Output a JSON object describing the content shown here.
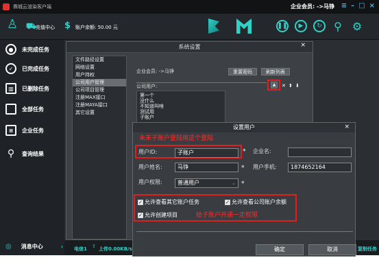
{
  "app": {
    "title": "赛城云渲染客户端",
    "member_label": "企业会员: ->马铮",
    "balance": "账户余额: 50.00 元",
    "recharge": "充值中心"
  },
  "sidebar": {
    "items": [
      {
        "label": "未完成任务",
        "icon": "circle-dot-icon"
      },
      {
        "label": "已完成任务",
        "icon": "check-circle-icon"
      },
      {
        "label": "已删除任务",
        "icon": "trash-icon"
      },
      {
        "label": "全部任务",
        "icon": "file-icon"
      },
      {
        "label": "企业任务",
        "icon": "list-icon"
      },
      {
        "label": "查询结果",
        "icon": "search-icon"
      }
    ],
    "messages": "消息中心"
  },
  "statusbar": {
    "network": "电信1",
    "upload": "上传0.00KB/s",
    "right": "复制任务"
  },
  "settings": {
    "title": "系统设置",
    "nav": [
      "文件路径设置",
      "网络设置",
      "用户持权",
      "公司用户管理",
      "公司项目管理",
      "注册MAX接口",
      "注册MAYA接口",
      "其它设置"
    ],
    "member": "企业会员: ->马铮",
    "reset_password": "重置密码",
    "refresh_list": "刷新列表",
    "company_user_label": "公司用户:",
    "users": [
      "第一个",
      "没什么",
      "不知道叫啥",
      "测试用",
      "子账户"
    ]
  },
  "user_dialog": {
    "title": "设置用户",
    "hint_top": "未来子账户登陆用这个登陆",
    "user_id_label": "用户ID:",
    "user_id": "子账户",
    "company_label": "企业名:",
    "company": "",
    "name_label": "用户姓名:",
    "name": "马铮",
    "phone_label": "用户手机:",
    "phone": "1874652164",
    "perm_label": "用户权限:",
    "perm": "普通用户",
    "cb1": "允许查看其它账户任务",
    "cb2": "允许查看公司账户余额",
    "cb3": "允许创建项目",
    "hint_bottom": "给子账户开通一定权限",
    "ok": "确定",
    "cancel": "取消",
    "required": "*"
  },
  "colors": {
    "accent": "#2fd2c8",
    "annotation": "#e02020"
  }
}
